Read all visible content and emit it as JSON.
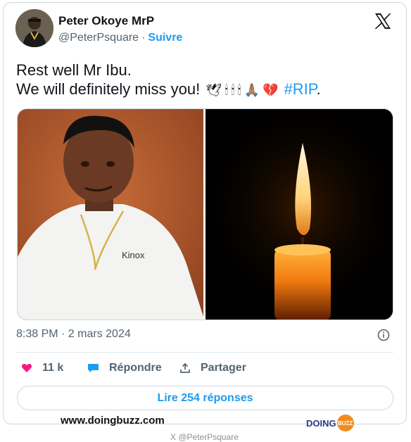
{
  "author": {
    "name": "Peter Okoye MrP",
    "handle": "@PeterPsquare",
    "separator": "·",
    "follow_label": "Suivre"
  },
  "tweet": {
    "line1": "Rest well Mr Ibu.",
    "line2_text": "We will definitely miss you!",
    "emojis": [
      "🕊",
      "🕯",
      "🕯",
      "🕯",
      "🙏🏽",
      "💔"
    ],
    "hashtag": "#RIP",
    "trailing": "."
  },
  "photo": {
    "shirt_brand": "Kinox"
  },
  "meta": {
    "timestamp": "8:38 PM · 2 mars 2024"
  },
  "actions": {
    "likes": "11 k",
    "reply_label": "Répondre",
    "share_label": "Partager"
  },
  "read_replies_label": "Lire 254 réponses",
  "watermark": {
    "site": "www.doingbuzz.com",
    "brand_left": "DOING",
    "brand_right": "BUZZ",
    "footer_handle": "X @PeterPsquare"
  },
  "colors": {
    "link": "#1d9bf0",
    "like": "#f91880",
    "text": "#0f1419",
    "muted": "#536471"
  }
}
